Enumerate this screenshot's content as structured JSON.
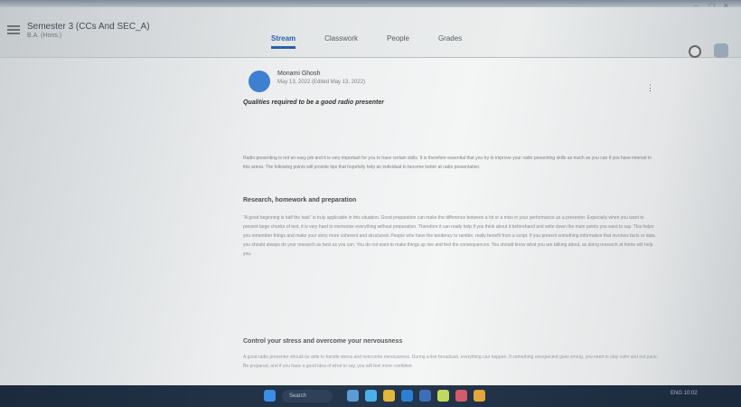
{
  "header": {
    "course_title": "Semester 3 (CCs And SEC_A)",
    "course_sub": "B.A. (Hons.)",
    "tabs": [
      {
        "label": "Stream",
        "active": true
      },
      {
        "label": "Classwork",
        "active": false
      },
      {
        "label": "People",
        "active": false
      },
      {
        "label": "Grades",
        "active": false
      }
    ]
  },
  "post": {
    "author": "Monami Ghosh",
    "date": "May 13, 2022 (Edited May 13, 2022)",
    "heading": "Qualities required to be a good radio presenter",
    "paragraph1": "Radio presenting is not an easy job and it is very important for you to have certain skills. It is therefore essential that you try to improve your radio presenting skills as much as you can if you have interest in this arena. The following points will provide tips that hopefully help an individual to become better at radio presentation.",
    "section1_title": "Research, homework and preparation",
    "paragraph2": "\"A good beginning is half the task\" is truly applicable in this situation. Good preparation can make the difference between a hit or a miss in your performance as a presenter. Especially when you want to present large chunks of text, it is very hard to memorise everything without preparation. Therefore it can really help if you think about it beforehand and write down the main points you want to say. This helps you remember things and make your story more coherent and structured. People who have the tendency to ramble, really benefit from a script. If you present something informative that involves facts or data, you should always do your research as best as you can. You do not want to make things up live and feel the consequences. You should know what you are talking about, as doing research at home will help you.",
    "section2_title": "Control your stress and overcome your nervousness",
    "paragraph3": "A good radio presenter should be able to handle stress and overcome nervousness. During a live broadcast, everything can happen. If something unexpected goes wrong, you need to stay calm and not panic. Be prepared, and if you have a good idea of what to say, you will feel more confident."
  },
  "taskbar": {
    "search_label": "Search",
    "tray_time": "ENG 10:02"
  }
}
